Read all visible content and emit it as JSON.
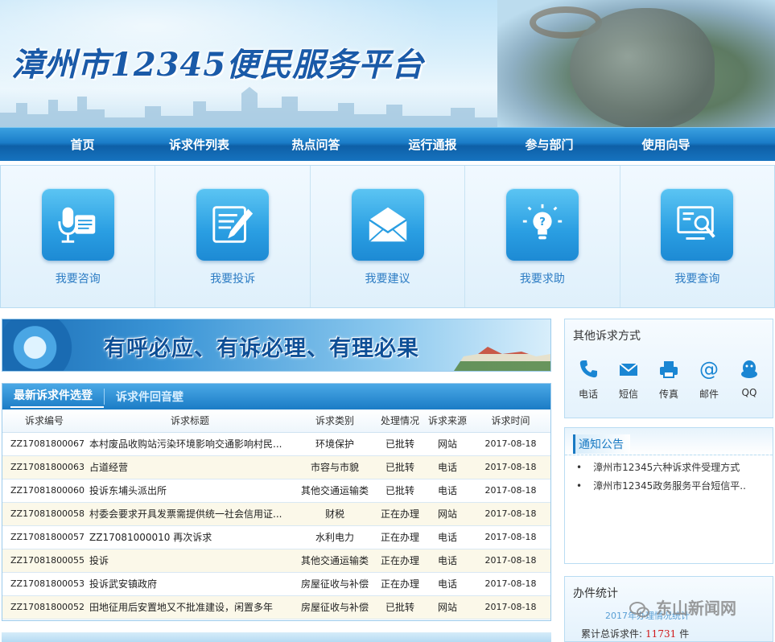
{
  "header": {
    "title": "漳州市12345便民服务平台"
  },
  "nav": {
    "items": [
      "首页",
      "诉求件列表",
      "热点问答",
      "运行通报",
      "参与部门",
      "使用向导"
    ]
  },
  "services": [
    {
      "label": "我要咨询",
      "icon": "microphone-document-icon"
    },
    {
      "label": "我要投诉",
      "icon": "pen-notepad-icon"
    },
    {
      "label": "我要建议",
      "icon": "envelope-icon"
    },
    {
      "label": "我要求助",
      "icon": "lightbulb-question-icon"
    },
    {
      "label": "我要查询",
      "icon": "monitor-search-icon"
    }
  ],
  "slogan": {
    "text": "有呼必应、有诉必理、有理必果"
  },
  "complaints": {
    "tabs": [
      "最新诉求件选登",
      "诉求件回音壁"
    ],
    "columns": [
      "诉求编号",
      "诉求标题",
      "诉求类别",
      "处理情况",
      "诉求来源",
      "诉求时间"
    ],
    "rows": [
      {
        "id": "ZZ17081800067",
        "title": "本村废品收购站污染环境影响交通影响村民...",
        "category": "环境保护",
        "status": "已批转",
        "source": "网站",
        "time": "2017-08-18"
      },
      {
        "id": "ZZ17081800063",
        "title": "占道经营",
        "category": "市容与市貌",
        "status": "已批转",
        "source": "电话",
        "time": "2017-08-18"
      },
      {
        "id": "ZZ17081800060",
        "title": "投诉东埔头派出所",
        "category": "其他交通运输类",
        "status": "已批转",
        "source": "电话",
        "time": "2017-08-18"
      },
      {
        "id": "ZZ17081800058",
        "title": "村委会要求开具发票需提供统一社会信用证...",
        "category": "财税",
        "status": "正在办理",
        "source": "网站",
        "time": "2017-08-18"
      },
      {
        "id": "ZZ17081800057",
        "title": "ZZ17081000010 再次诉求",
        "category": "水利电力",
        "status": "正在办理",
        "source": "电话",
        "time": "2017-08-18"
      },
      {
        "id": "ZZ17081800055",
        "title": "投诉",
        "category": "其他交通运输类",
        "status": "正在办理",
        "source": "电话",
        "time": "2017-08-18"
      },
      {
        "id": "ZZ17081800053",
        "title": "投诉武安镇政府",
        "category": "房屋征收与补偿",
        "status": "正在办理",
        "source": "电话",
        "time": "2017-08-18"
      },
      {
        "id": "ZZ17081800052",
        "title": "田地征用后安置地又不批准建设，闲置多年",
        "category": "房屋征收与补偿",
        "status": "已批转",
        "source": "网站",
        "time": "2017-08-18"
      }
    ]
  },
  "contact": {
    "title": "其他诉求方式",
    "items": [
      {
        "label": "电话",
        "icon": "phone-icon"
      },
      {
        "label": "短信",
        "icon": "envelope-icon"
      },
      {
        "label": "传真",
        "icon": "fax-icon"
      },
      {
        "label": "邮件",
        "icon": "at-sign-icon"
      },
      {
        "label": "QQ",
        "icon": "qq-penguin-icon"
      }
    ]
  },
  "notice": {
    "title": "通知公告",
    "items": [
      "漳州市12345六种诉求件受理方式",
      "漳州市12345政务服务平台短信平.."
    ]
  },
  "stats": {
    "title": "办件统计",
    "year_caption": "2017年办理情况统计",
    "total_label": "累计总诉求件:",
    "total_value": "11731",
    "total_unit": "件"
  },
  "watermark": {
    "text": "东山新闻网"
  },
  "colors": {
    "primary": "#1a7cc8",
    "accent_red": "#d0181a",
    "link": "#2c7cc4"
  }
}
